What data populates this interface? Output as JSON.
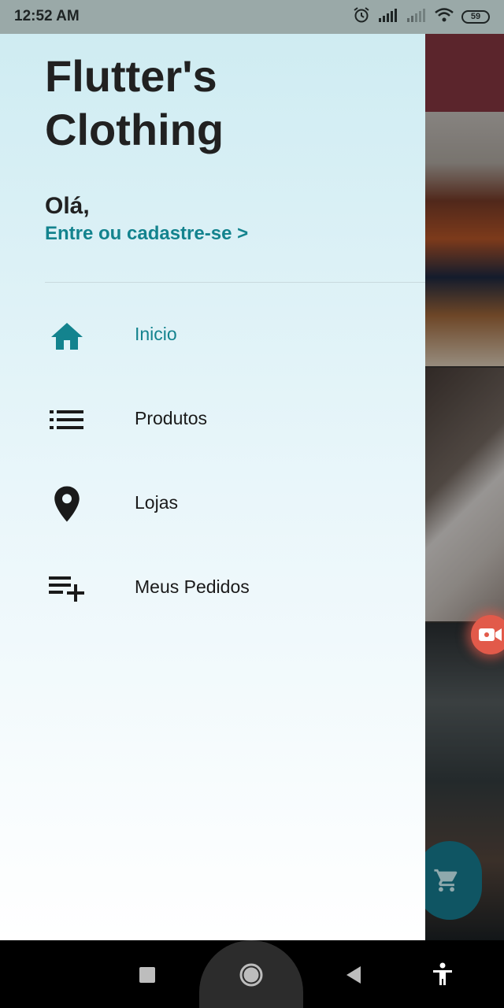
{
  "status_bar": {
    "time": "12:52 AM",
    "battery": "59",
    "icons": [
      "alarm-icon",
      "signal-icon",
      "signal-weak-icon",
      "wifi-icon",
      "battery-icon"
    ]
  },
  "drawer": {
    "brand_title": "Flutter's Clothing",
    "greeting": "Olá,",
    "signin_link": "Entre ou cadastre-se >",
    "menu": [
      {
        "label": "Inicio",
        "icon": "home-icon",
        "active": true
      },
      {
        "label": "Produtos",
        "icon": "list-icon",
        "active": false
      },
      {
        "label": "Lojas",
        "icon": "location-pin-icon",
        "active": false
      },
      {
        "label": "Meus Pedidos",
        "icon": "playlist-add-icon",
        "active": false
      }
    ]
  },
  "colors": {
    "accent": "#13838e",
    "text": "#212121",
    "drawer_top": "#cfecf2",
    "drawer_bottom": "#ffffff",
    "status_bar": "#9aa9a8"
  },
  "background_app": {
    "icons": [
      "video-record-icon",
      "shopping-cart-icon"
    ]
  },
  "nav_bar": {
    "icons": [
      "recent-apps-icon",
      "home-button-icon",
      "back-icon",
      "accessibility-icon"
    ]
  }
}
